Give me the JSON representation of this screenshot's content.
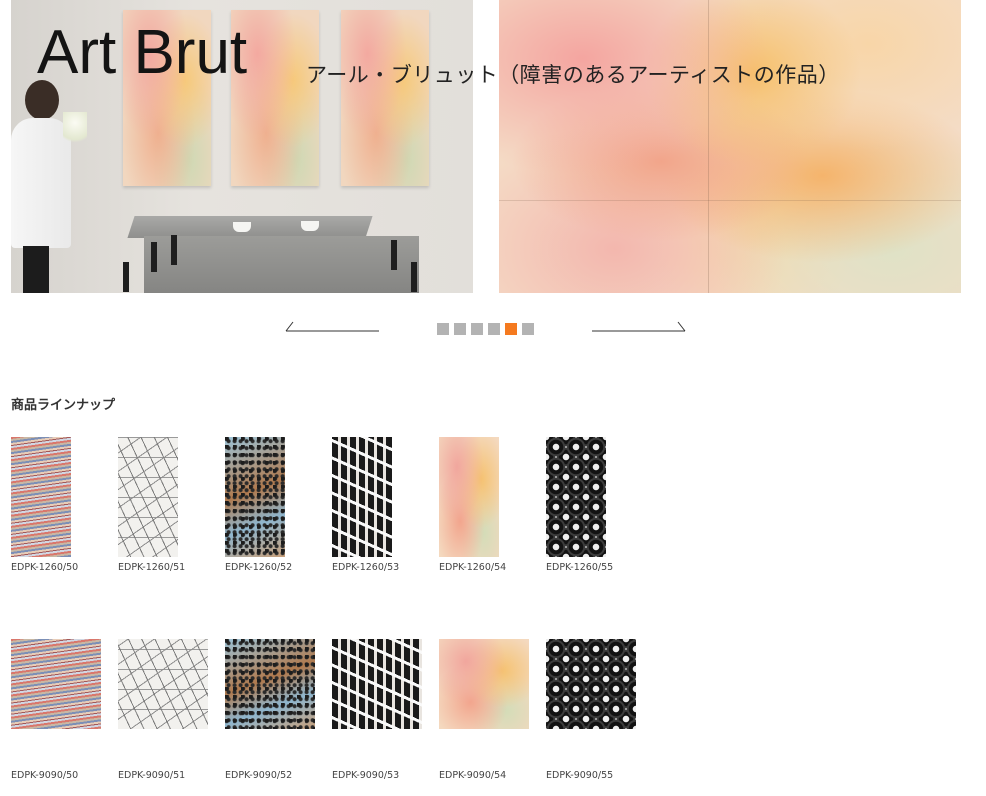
{
  "hero": {
    "title": "Art Brut",
    "subtitle": "アール・ブリュット（障害のあるアーティストの作品）"
  },
  "carousel": {
    "prev_icon": "arrow-left-icon",
    "next_icon": "arrow-right-icon",
    "slide_count": 6,
    "active_index": 4,
    "accent_color": "#f57a1f",
    "dot_color": "#b3b3b3"
  },
  "lineup": {
    "title": "商品ラインナップ",
    "row1": [
      {
        "code": "EDPK-1260/50",
        "pattern": "stripes"
      },
      {
        "code": "EDPK-1260/51",
        "pattern": "lines"
      },
      {
        "code": "EDPK-1260/52",
        "pattern": "leopard"
      },
      {
        "code": "EDPK-1260/53",
        "pattern": "letters"
      },
      {
        "code": "EDPK-1260/54",
        "pattern": "watercolor"
      },
      {
        "code": "EDPK-1260/55",
        "pattern": "rings"
      }
    ],
    "row2": [
      {
        "code": "EDPK-9090/50",
        "pattern": "stripes"
      },
      {
        "code": "EDPK-9090/51",
        "pattern": "lines"
      },
      {
        "code": "EDPK-9090/52",
        "pattern": "leopard"
      },
      {
        "code": "EDPK-9090/53",
        "pattern": "letters"
      },
      {
        "code": "EDPK-9090/54",
        "pattern": "watercolor"
      },
      {
        "code": "EDPK-9090/55",
        "pattern": "rings"
      }
    ]
  }
}
